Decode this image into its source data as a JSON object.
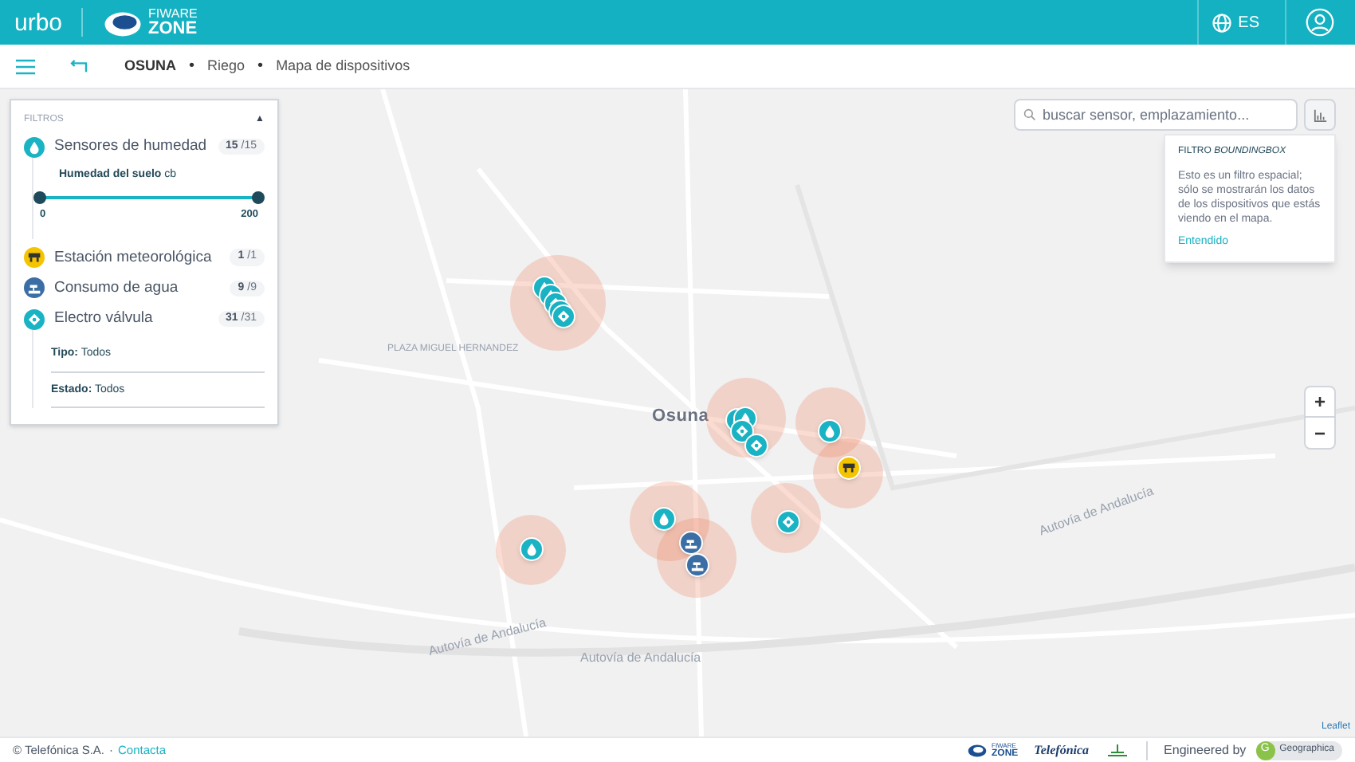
{
  "header": {
    "logo": "urbo",
    "partner_logo": [
      "FIWARE",
      "ZONE"
    ],
    "language": "ES"
  },
  "breadcrumb": [
    "OSUNA",
    "Riego",
    "Mapa de dispositivos"
  ],
  "breadcrumb_separator": "•",
  "filters": {
    "title": "FILTROS",
    "expanded": true,
    "toggle_symbol": "▲",
    "items": [
      {
        "kind": "humidity",
        "name": "Sensores de humedad",
        "count": "15",
        "total": "/15",
        "slider": {
          "label": "Humedad del suelo",
          "unit": "cb",
          "min": "0",
          "max": "200",
          "level": 1
        }
      },
      {
        "kind": "weather",
        "name": "Estación meteorológica",
        "count": "1",
        "total": "/1"
      },
      {
        "kind": "water",
        "name": "Consumo de agua",
        "count": "9",
        "total": "/9"
      },
      {
        "kind": "valve",
        "name": "Electro válvula",
        "count": "31",
        "total": "/31",
        "subfilters": [
          {
            "label": "Tipo:",
            "value": "Todos"
          },
          {
            "label": "Estado:",
            "value": "Todos"
          }
        ]
      }
    ]
  },
  "search": {
    "placeholder": "buscar sensor, emplazamiento..."
  },
  "tooltip": {
    "title": "FILTRO",
    "title_emphasis": "BOUNDINGBOX",
    "text": "Esto es un filtro espacial; sólo se mostrarán los datos de los dispositivos que estás viendo en el mapa.",
    "action": "Entendido"
  },
  "zoom": [
    "+",
    "−"
  ],
  "map": {
    "labels": [
      {
        "kind": "town",
        "text": "Osuna"
      },
      {
        "kind": "road",
        "text": "Autovía de Andalucía"
      },
      {
        "kind": "road",
        "text": "Autovía de Andalucía"
      },
      {
        "kind": "road",
        "text": "Autovía de Andalucía"
      },
      {
        "kind": "place",
        "text": "PLAZA MIGUEL HERNANDEZ"
      }
    ],
    "markers": [
      {
        "kind": "humidity"
      },
      {
        "kind": "humidity"
      },
      {
        "kind": "valve"
      },
      {
        "kind": "valve"
      },
      {
        "kind": "valve"
      },
      {
        "kind": "humidity"
      },
      {
        "kind": "humidity"
      },
      {
        "kind": "valve"
      },
      {
        "kind": "valve"
      },
      {
        "kind": "humidity"
      },
      {
        "kind": "weather"
      },
      {
        "kind": "humidity"
      },
      {
        "kind": "water"
      },
      {
        "kind": "water"
      },
      {
        "kind": "valve"
      },
      {
        "kind": "humidity"
      }
    ],
    "attribution": "Leaflet"
  },
  "footer": {
    "copyright": "© Telefónica S.A.",
    "separator": "·",
    "link": "Contacta",
    "logos": [
      "FIWARE",
      "ZONE",
      "Telefónica"
    ],
    "engineered": "Engineered by",
    "brand_initial": "G",
    "brand": "Geographica"
  }
}
